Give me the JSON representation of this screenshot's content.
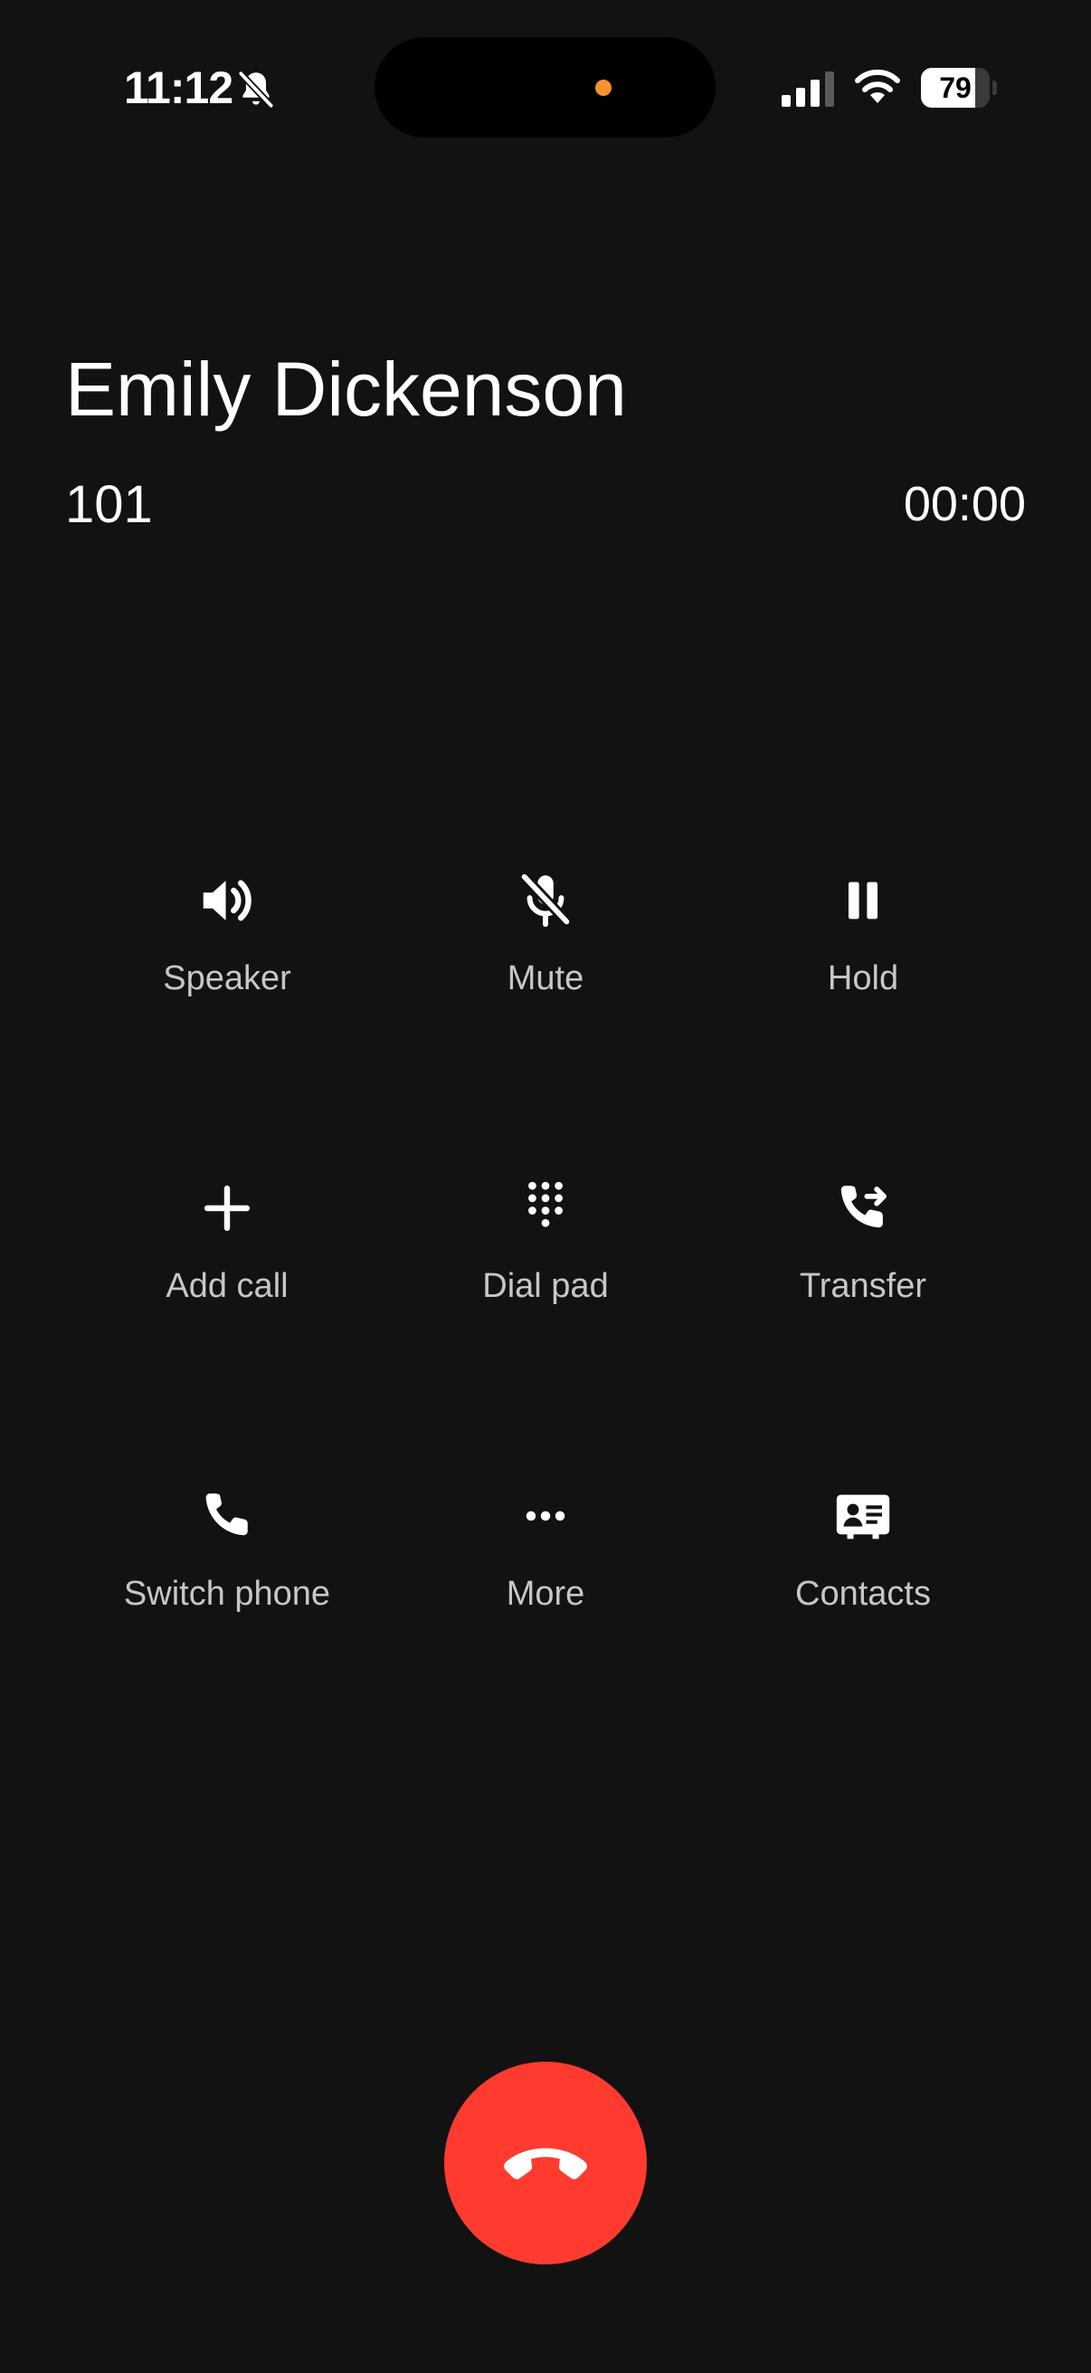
{
  "status_bar": {
    "time": "11:12",
    "battery_level": "79",
    "battery_fraction": 0.79,
    "icons": [
      "bell-slash-icon",
      "cellular-signal-icon",
      "wifi-icon",
      "battery-icon"
    ],
    "privacy_indicator_color": "#f5922f"
  },
  "caller": {
    "name": "Emily Dickenson",
    "number": "101",
    "duration": "00:00"
  },
  "controls": [
    {
      "id": "speaker",
      "label": "Speaker",
      "icon": "speaker-icon"
    },
    {
      "id": "mute",
      "label": "Mute",
      "icon": "mic-off-icon"
    },
    {
      "id": "hold",
      "label": "Hold",
      "icon": "pause-icon"
    },
    {
      "id": "add-call",
      "label": "Add call",
      "icon": "plus-icon"
    },
    {
      "id": "dial-pad",
      "label": "Dial pad",
      "icon": "dialpad-icon"
    },
    {
      "id": "transfer",
      "label": "Transfer",
      "icon": "call-transfer-icon"
    },
    {
      "id": "switch-phone",
      "label": "Switch phone",
      "icon": "phone-icon"
    },
    {
      "id": "more",
      "label": "More",
      "icon": "more-icon"
    },
    {
      "id": "contacts",
      "label": "Contacts",
      "icon": "contact-card-icon"
    }
  ],
  "end_call": {
    "icon": "hang-up-icon",
    "color": "#ff3b30"
  },
  "theme": {
    "background": "#121212",
    "label_color": "#c7c7c7"
  }
}
